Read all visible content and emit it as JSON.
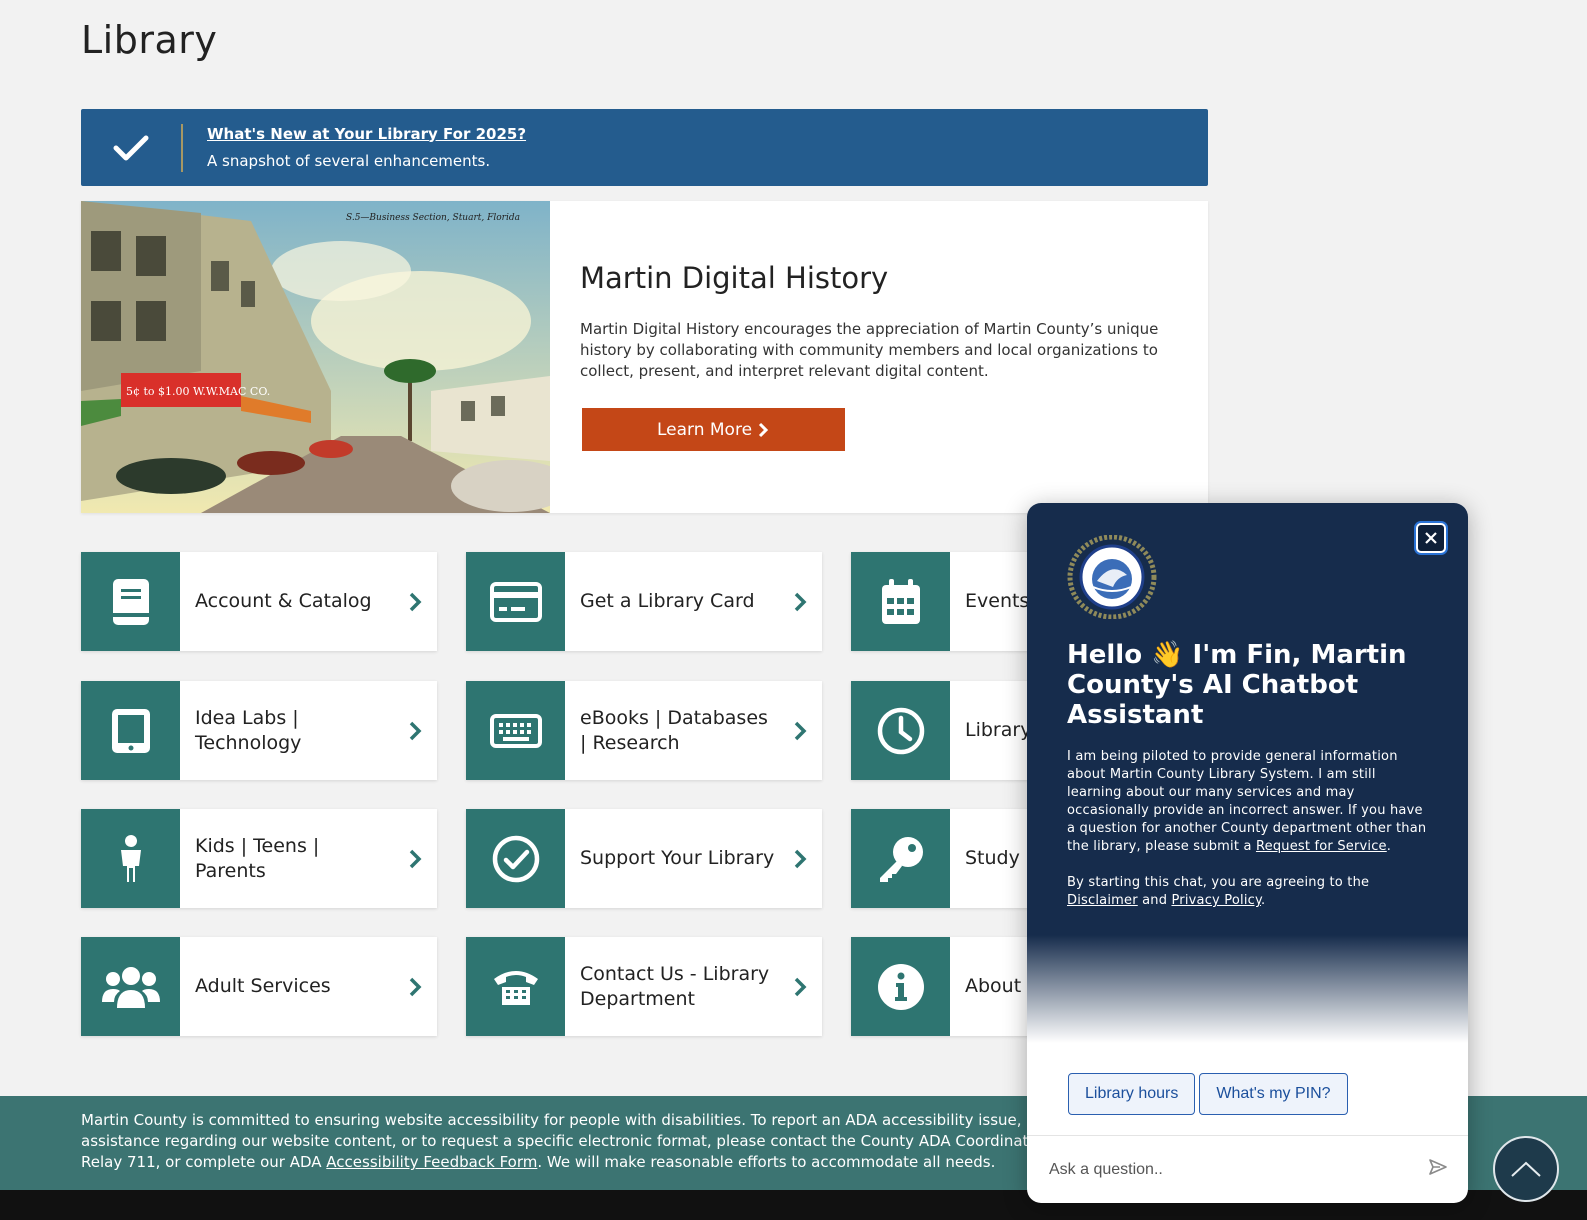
{
  "page": {
    "title": "Library"
  },
  "alert": {
    "link_text": "What's New at Your Library For 2025?",
    "subtitle": "A snapshot of several enhancements."
  },
  "feature": {
    "title": "Martin Digital History",
    "description": "Martin Digital History encourages the appreciation of Martin County’s unique history by collaborating with community members and local organizations to collect, present, and interpret relevant digital content.",
    "button_label": "Learn More",
    "postcard_caption": "S.5—Business Section, Stuart, Florida",
    "postcard_sign": "5¢ to $1.00  W.W.MAC CO."
  },
  "tiles": [
    {
      "label": "Account & Catalog",
      "icon": "book-icon"
    },
    {
      "label": "Get a Library Card",
      "icon": "credit-card-icon"
    },
    {
      "label": "Events Clubs",
      "icon": "calendar-icon"
    },
    {
      "label": "Idea Labs | Technology",
      "icon": "tablet-icon"
    },
    {
      "label": "eBooks | Databases | Research",
      "icon": "keyboard-icon"
    },
    {
      "label": "Library Locatic",
      "icon": "clock-icon"
    },
    {
      "label": "Kids | Teens | Parents",
      "icon": "child-icon"
    },
    {
      "label": "Support Your Library",
      "icon": "check-circle-icon"
    },
    {
      "label": "Study | Studios",
      "icon": "key-icon"
    },
    {
      "label": "Adult Services",
      "icon": "users-icon"
    },
    {
      "label": "Contact Us - Library Department",
      "icon": "phone-icon"
    },
    {
      "label": "About",
      "icon": "info-icon"
    }
  ],
  "footer": {
    "text_before": "Martin County is committed to ensuring website accessibility for people with disabilities. To report an ADA accessibility issue, rec",
    "text_line2": "assistance regarding our website content, or to request a specific electronic format, please contact the County ADA Coordinator",
    "text_line3_before": "Relay 711, or complete our ADA ",
    "link_label": "Accessibility Feedback Form",
    "text_after": ". We will make reasonable efforts to accommodate all needs."
  },
  "chat": {
    "greeting": "Hello 👋 I'm Fin, Martin County's AI Chatbot Assistant",
    "intro_before": "I am being piloted to provide general information about Martin County Library System. I am still learning about our many services and may occasionally provide an incorrect answer. If you have a question for another County department other than the library, please submit a ",
    "intro_link": "Request for Service",
    "intro_after": ".",
    "consent_before": "By starting this chat, you are agreeing to the ",
    "disclaimer_link": "Disclaimer",
    "consent_and": " and ",
    "privacy_link": "Privacy Policy",
    "consent_after": ".",
    "chips": [
      "Library hours",
      "What's my PIN?"
    ],
    "input_placeholder": "Ask a question..",
    "seal_text": "COUNTY OF MARTIN · STATE OF FLORIDA"
  },
  "colors": {
    "alert_bg": "#245c8e",
    "tile_icon_bg": "#2e7571",
    "button_bg": "#c44717",
    "chat_bg": "#162c4c",
    "footer_bg": "#3c7472"
  }
}
